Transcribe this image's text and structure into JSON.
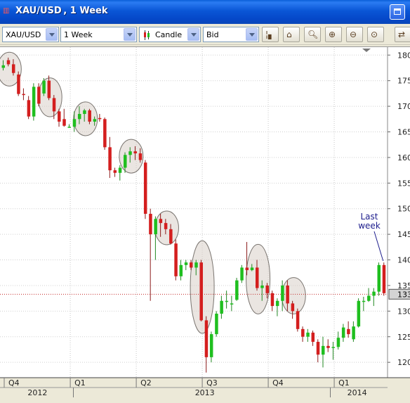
{
  "window": {
    "title": "XAU/USD , 1 Week"
  },
  "toolbar": {
    "instrument": "XAU/USD",
    "period": "1 Week",
    "chart_type": "Candle",
    "price_side": "Bid"
  },
  "colors": {
    "up": "#1fbf1f",
    "down": "#d41e1e",
    "circle_fill": "#d8cfc8",
    "annotation": "#1c1c8c",
    "price_line": "#c42a2a"
  },
  "chart_data": {
    "type": "candlestick",
    "ylim": [
      1170,
      1810
    ],
    "yticks": [
      "180",
      "175",
      "170",
      "165",
      "160",
      "155",
      "150",
      "145",
      "140",
      "135",
      "130",
      "125",
      "120"
    ],
    "ytick_values": [
      1800,
      1750,
      1700,
      1650,
      1600,
      1550,
      1500,
      1450,
      1400,
      1350,
      1300,
      1250,
      1200
    ],
    "current_price_label": "133",
    "current_price": 1333,
    "quarter_labels": [
      {
        "label": "Q4",
        "week": 0
      },
      {
        "label": "Q1",
        "week": 14
      },
      {
        "label": "Q2",
        "week": 27
      },
      {
        "label": "Q3",
        "week": 40
      },
      {
        "label": "Q4",
        "week": 53
      },
      {
        "label": "Q1",
        "week": 66
      }
    ],
    "year_labels": [
      {
        "label": "2012",
        "week": 4
      },
      {
        "label": "2013",
        "week": 40
      },
      {
        "label": "2014",
        "week": 70
      }
    ],
    "annotation": "Last week",
    "annotation_lines": [
      "Last",
      "week"
    ],
    "candles": [
      [
        1775,
        1790,
        1770,
        1780
      ],
      [
        1790,
        1795,
        1778,
        1782
      ],
      [
        1782,
        1792,
        1760,
        1765
      ],
      [
        1762,
        1768,
        1720,
        1724
      ],
      [
        1724,
        1735,
        1712,
        1722
      ],
      [
        1712,
        1720,
        1675,
        1680
      ],
      [
        1680,
        1745,
        1672,
        1738
      ],
      [
        1738,
        1745,
        1700,
        1705
      ],
      [
        1725,
        1755,
        1720,
        1750
      ],
      [
        1750,
        1760,
        1712,
        1716
      ],
      [
        1716,
        1722,
        1675,
        1690
      ],
      [
        1690,
        1695,
        1660,
        1670
      ],
      [
        1675,
        1695,
        1660,
        1662
      ],
      [
        1658,
        1665,
        1658,
        1660
      ],
      [
        1660,
        1690,
        1650,
        1675
      ],
      [
        1675,
        1700,
        1665,
        1685
      ],
      [
        1685,
        1695,
        1670,
        1692
      ],
      [
        1692,
        1695,
        1665,
        1670
      ],
      [
        1670,
        1680,
        1662,
        1675
      ],
      [
        1677,
        1685,
        1670,
        1675
      ],
      [
        1675,
        1678,
        1615,
        1620
      ],
      [
        1620,
        1640,
        1560,
        1575
      ],
      [
        1575,
        1580,
        1562,
        1570
      ],
      [
        1570,
        1585,
        1555,
        1580
      ],
      [
        1580,
        1610,
        1570,
        1605
      ],
      [
        1605,
        1620,
        1590,
        1612
      ],
      [
        1612,
        1622,
        1595,
        1608
      ],
      [
        1608,
        1618,
        1590,
        1595
      ],
      [
        1590,
        1595,
        1480,
        1490
      ],
      [
        1490,
        1500,
        1320,
        1450
      ],
      [
        1450,
        1485,
        1400,
        1480
      ],
      [
        1480,
        1490,
        1445,
        1472
      ],
      [
        1472,
        1480,
        1450,
        1460
      ],
      [
        1460,
        1470,
        1430,
        1432
      ],
      [
        1432,
        1440,
        1360,
        1368
      ],
      [
        1368,
        1400,
        1360,
        1390
      ],
      [
        1390,
        1400,
        1380,
        1395
      ],
      [
        1395,
        1400,
        1380,
        1385
      ],
      [
        1385,
        1400,
        1370,
        1395
      ],
      [
        1395,
        1400,
        1280,
        1282
      ],
      [
        1282,
        1290,
        1180,
        1210
      ],
      [
        1210,
        1260,
        1200,
        1255
      ],
      [
        1255,
        1300,
        1250,
        1295
      ],
      [
        1295,
        1330,
        1285,
        1320
      ],
      [
        1320,
        1340,
        1305,
        1320
      ],
      [
        1315,
        1330,
        1300,
        1315
      ],
      [
        1322,
        1365,
        1320,
        1360
      ],
      [
        1360,
        1390,
        1355,
        1385
      ],
      [
        1385,
        1435,
        1370,
        1380
      ],
      [
        1380,
        1392,
        1378,
        1385
      ],
      [
        1385,
        1400,
        1340,
        1345
      ],
      [
        1345,
        1360,
        1320,
        1350
      ],
      [
        1350,
        1355,
        1325,
        1335
      ],
      [
        1335,
        1340,
        1300,
        1310
      ],
      [
        1310,
        1325,
        1290,
        1320
      ],
      [
        1320,
        1360,
        1300,
        1350
      ],
      [
        1350,
        1360,
        1300,
        1315
      ],
      [
        1315,
        1320,
        1285,
        1300
      ],
      [
        1300,
        1305,
        1260,
        1265
      ],
      [
        1265,
        1270,
        1240,
        1250
      ],
      [
        1250,
        1265,
        1240,
        1258
      ],
      [
        1258,
        1262,
        1232,
        1240
      ],
      [
        1240,
        1245,
        1200,
        1215
      ],
      [
        1215,
        1250,
        1190,
        1232
      ],
      [
        1232,
        1245,
        1220,
        1228
      ],
      [
        1228,
        1240,
        1205,
        1230
      ],
      [
        1230,
        1260,
        1225,
        1248
      ],
      [
        1248,
        1275,
        1240,
        1268
      ],
      [
        1265,
        1280,
        1248,
        1255
      ],
      [
        1245,
        1280,
        1240,
        1270
      ],
      [
        1270,
        1325,
        1268,
        1320
      ],
      [
        1320,
        1328,
        1300,
        1320
      ],
      [
        1320,
        1345,
        1318,
        1330
      ],
      [
        1330,
        1345,
        1310,
        1338
      ],
      [
        1338,
        1395,
        1330,
        1390
      ],
      [
        1390,
        1395,
        1330,
        1335
      ]
    ],
    "circles": [
      {
        "week": 1,
        "low": 1745,
        "high": 1800
      },
      {
        "week": 9,
        "low": 1685,
        "high": 1750
      },
      {
        "week": 16,
        "low": 1648,
        "high": 1703
      },
      {
        "week": 25,
        "low": 1575,
        "high": 1630
      },
      {
        "week": 32,
        "low": 1435,
        "high": 1490
      },
      {
        "week": 39,
        "low": 1262,
        "high": 1432
      },
      {
        "week": 50,
        "low": 1300,
        "high": 1425
      },
      {
        "week": 57,
        "low": 1300,
        "high": 1360
      }
    ]
  }
}
